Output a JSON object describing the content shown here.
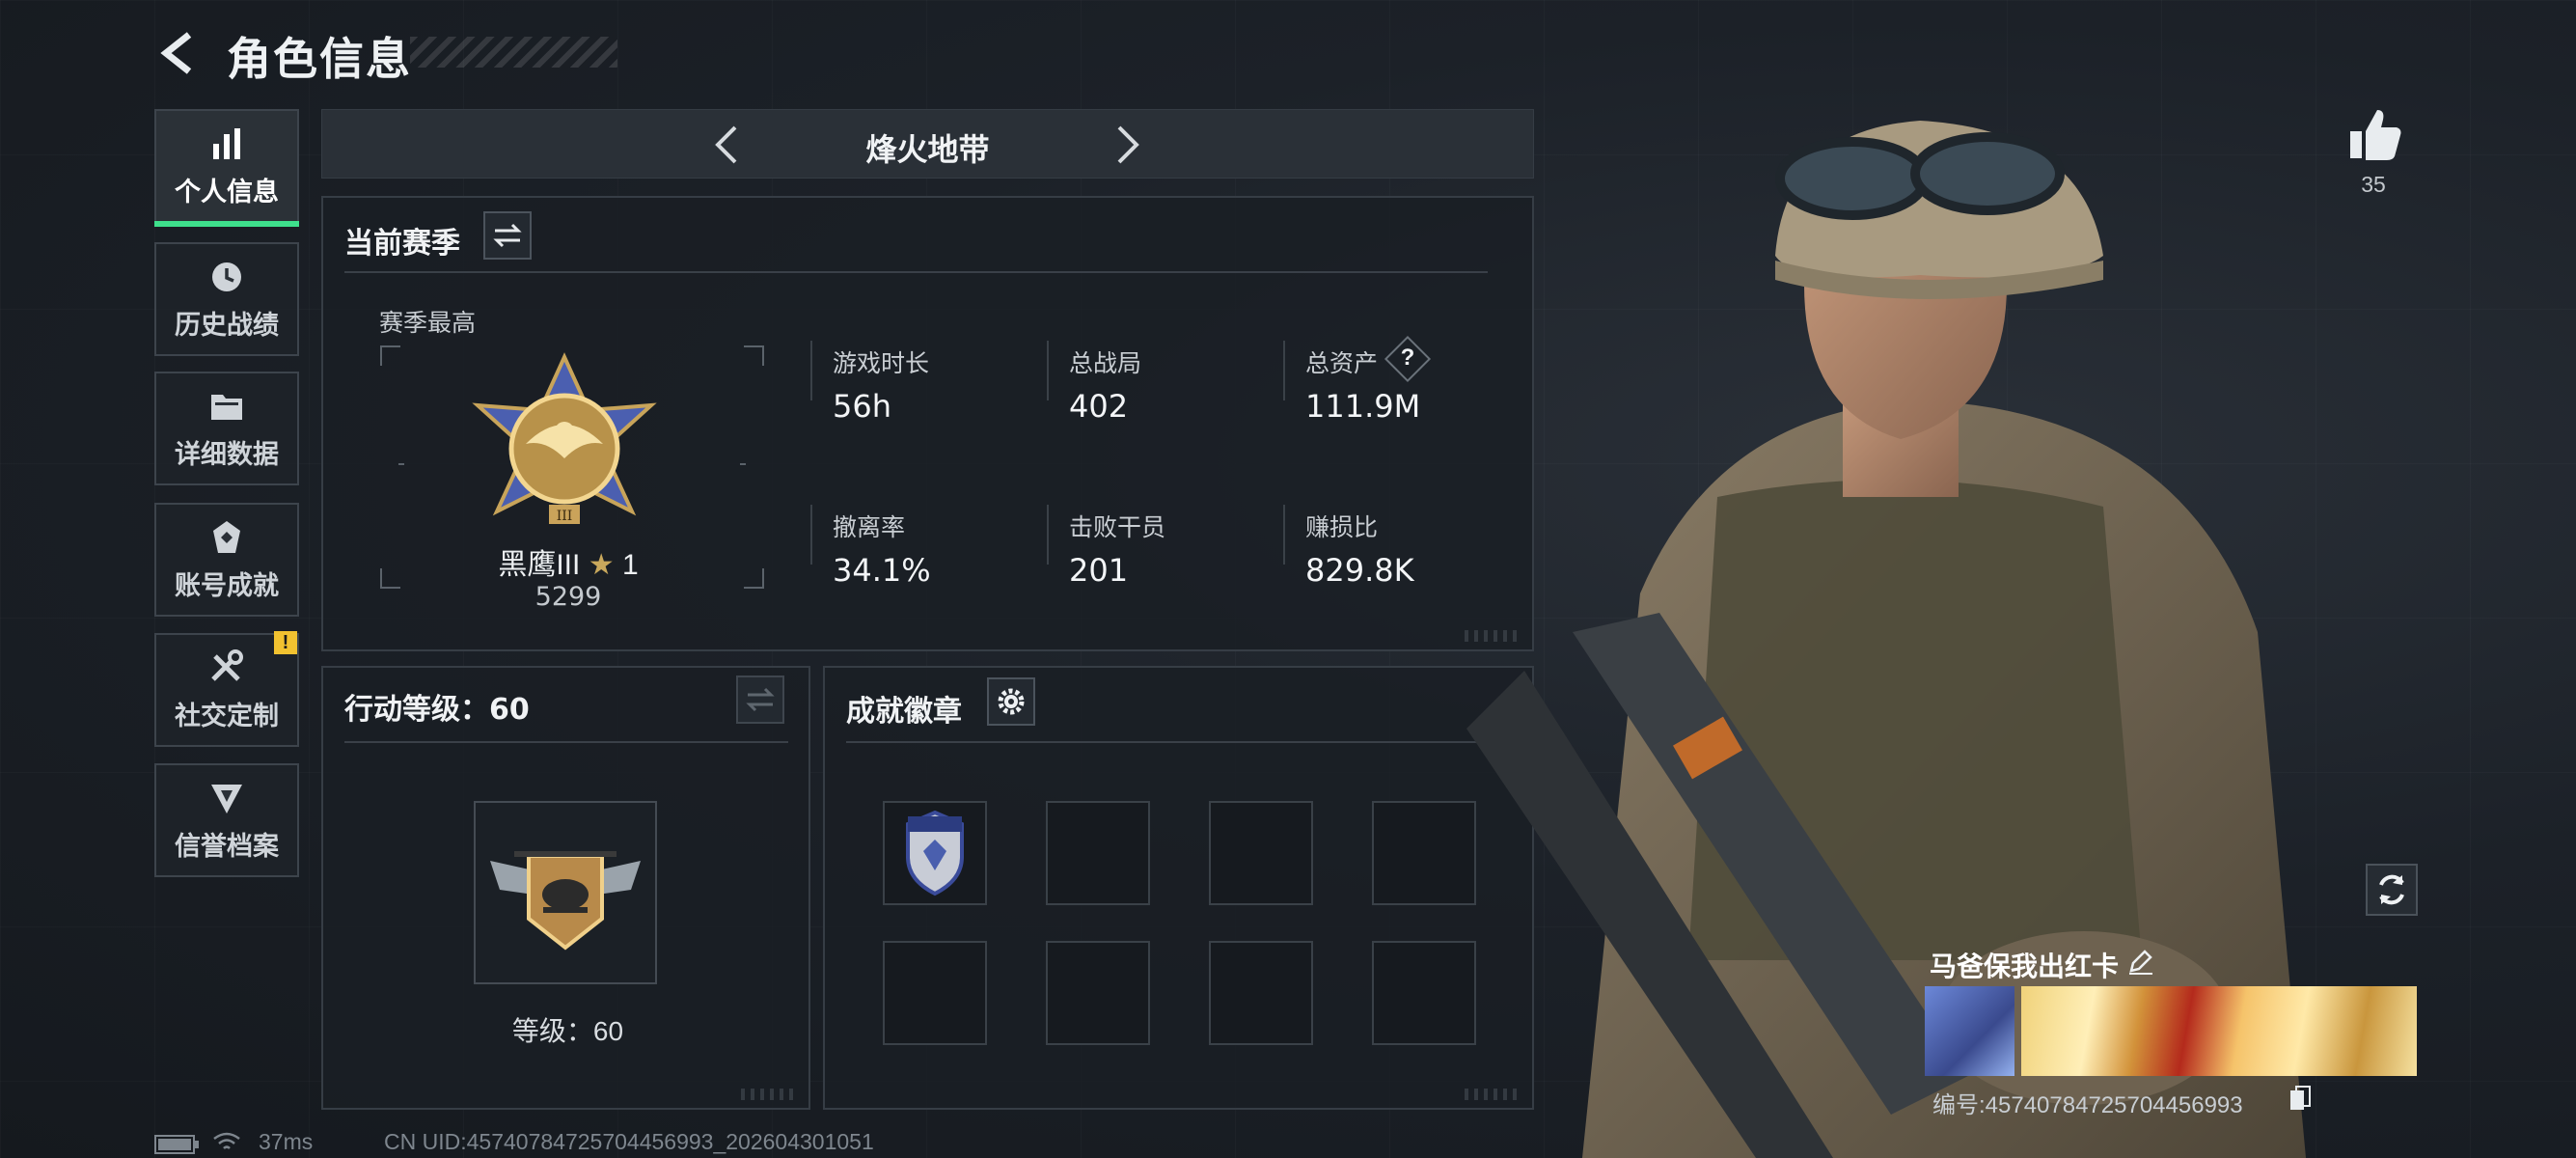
{
  "header": {
    "title": "角色信息"
  },
  "sidebar": {
    "items": [
      {
        "label": "个人信息",
        "icon": "bar-chart-icon",
        "active": true
      },
      {
        "label": "历史战绩",
        "icon": "history-clock-icon"
      },
      {
        "label": "详细数据",
        "icon": "folder-icon"
      },
      {
        "label": "账号成就",
        "icon": "achievement-icon"
      },
      {
        "label": "社交定制",
        "icon": "tools-icon",
        "badge": "!"
      },
      {
        "label": "信誉档案",
        "icon": "reputation-icon"
      }
    ]
  },
  "modebar": {
    "mode": "烽火地带"
  },
  "season": {
    "title": "当前赛季",
    "best_label": "赛季最高",
    "rank_name": "黑鹰III",
    "rank_stars": "1",
    "rank_points": "5299",
    "stats": [
      {
        "label": "游戏时长",
        "value": "56h"
      },
      {
        "label": "总战局",
        "value": "402"
      },
      {
        "label": "总资产",
        "value": "111.9M",
        "help": "?"
      },
      {
        "label": "撤离率",
        "value": "34.1%"
      },
      {
        "label": "击败干员",
        "value": "201"
      },
      {
        "label": "赚损比",
        "value": "829.8K"
      }
    ]
  },
  "action_level": {
    "title": "行动等级：60",
    "level_text": "等级：60"
  },
  "achievements": {
    "title": "成就徽章"
  },
  "like": {
    "count": "35"
  },
  "card": {
    "name": "马爸保我出红卡",
    "id_text": "编号:457407847257044569​93"
  },
  "footer": {
    "ping": "37ms",
    "uid": "CN UID:457407847257044569​93_202604301051"
  },
  "colors": {
    "accent": "#3ee08c",
    "warning": "#f2c230"
  }
}
